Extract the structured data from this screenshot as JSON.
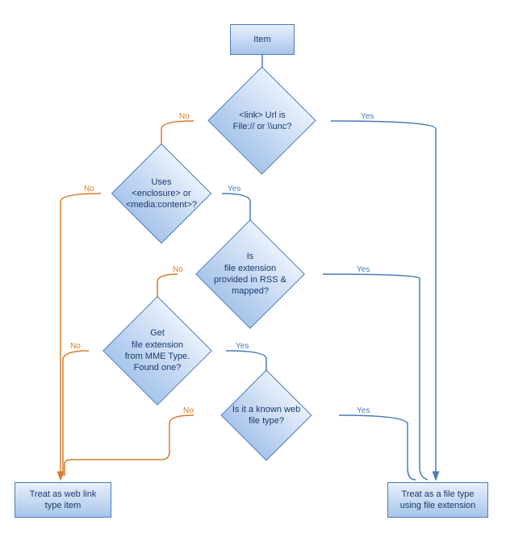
{
  "chart_data": {
    "type": "flowchart",
    "nodes": [
      {
        "id": "n1",
        "type": "start",
        "label": "Item"
      },
      {
        "id": "n2",
        "type": "decision",
        "label": "<link> Url is\nFile:// or \\\\unc?"
      },
      {
        "id": "n3",
        "type": "decision",
        "label": "Uses\n<enclosure> or\n<media:content>?"
      },
      {
        "id": "n4",
        "type": "decision",
        "label": "Is\nfile extension\nprovided in RSS &\nmapped?"
      },
      {
        "id": "n5",
        "type": "decision",
        "label": "Get\nfile extension\nfrom MME Type.\nFound one?"
      },
      {
        "id": "n6",
        "type": "decision",
        "label": "Is it a known web\nfile type?"
      },
      {
        "id": "n7",
        "type": "end",
        "label": "Treat as web link\ntype item"
      },
      {
        "id": "n8",
        "type": "end",
        "label": "Treat as a file type\nusing file extension"
      }
    ],
    "edges": [
      {
        "from": "n1",
        "to": "n2",
        "label": ""
      },
      {
        "from": "n2",
        "to": "n8",
        "label": "Yes"
      },
      {
        "from": "n2",
        "to": "n3",
        "label": "No"
      },
      {
        "from": "n3",
        "to": "n4",
        "label": "Yes"
      },
      {
        "from": "n3",
        "to": "n7",
        "label": "No"
      },
      {
        "from": "n4",
        "to": "n8",
        "label": "Yes"
      },
      {
        "from": "n4",
        "to": "n5",
        "label": "No"
      },
      {
        "from": "n5",
        "to": "n6",
        "label": "Yes"
      },
      {
        "from": "n5",
        "to": "n7",
        "label": "No"
      },
      {
        "from": "n6",
        "to": "n8",
        "label": "Yes"
      },
      {
        "from": "n6",
        "to": "n7",
        "label": "No"
      }
    ]
  },
  "labels": {
    "yes": "Yes",
    "no": "No"
  },
  "n1": "Item",
  "n2": "<link> Url is\nFile:// or \\\\unc?",
  "n3": "Uses\n<enclosure> or\n<media:content>?",
  "n4": "Is\nfile extension\nprovided in RSS &\nmapped?",
  "n5": "Get\nfile extension\nfrom MME Type.\nFound one?",
  "n6": "Is it a known web\nfile type?",
  "n7": "Treat as web link\ntype item",
  "n8": "Treat as a file type\nusing file extension"
}
